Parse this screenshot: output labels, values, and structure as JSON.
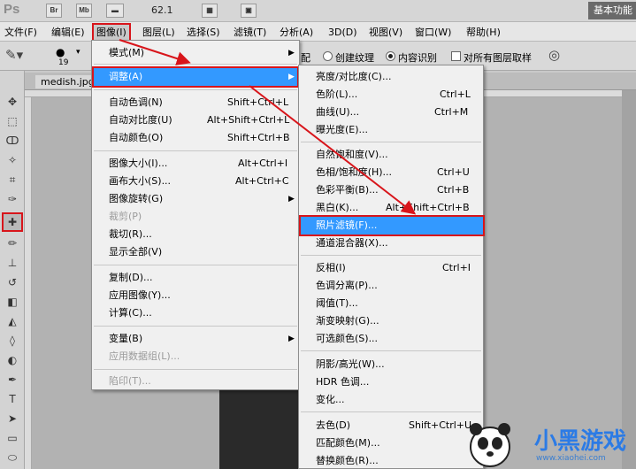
{
  "app": {
    "logo": "Ps",
    "mini_buttons": [
      "Br",
      "Mb"
    ],
    "zoom": "62.1",
    "workspace": "基本功能"
  },
  "menubar": {
    "items": [
      "文件(F)",
      "编辑(E)",
      "图像(I)",
      "图层(L)",
      "选择(S)",
      "滤镜(T)",
      "分析(A)",
      "3D(D)",
      "视图(V)",
      "窗口(W)",
      "帮助(H)"
    ]
  },
  "options": {
    "brush_size": "19",
    "partial_label": "配",
    "radio_create_texture": "创建纹理",
    "radio_content_aware": "内容识别",
    "checkbox_all_layers": "对所有图层取样"
  },
  "document": {
    "tab": "medish.jpg @"
  },
  "image_menu": {
    "items": [
      {
        "label": "模式(M)",
        "shortcut": "",
        "submenu": true,
        "disabled": false
      },
      {
        "label": "调整(A)",
        "shortcut": "",
        "submenu": true,
        "disabled": false
      },
      {
        "label": "自动色调(N)",
        "shortcut": "Shift+Ctrl+L",
        "submenu": false,
        "disabled": false
      },
      {
        "label": "自动对比度(U)",
        "shortcut": "Alt+Shift+Ctrl+L",
        "submenu": false,
        "disabled": false
      },
      {
        "label": "自动颜色(O)",
        "shortcut": "Shift+Ctrl+B",
        "submenu": false,
        "disabled": false
      },
      {
        "label": "图像大小(I)...",
        "shortcut": "Alt+Ctrl+I",
        "submenu": false,
        "disabled": false
      },
      {
        "label": "画布大小(S)...",
        "shortcut": "Alt+Ctrl+C",
        "submenu": false,
        "disabled": false
      },
      {
        "label": "图像旋转(G)",
        "shortcut": "",
        "submenu": true,
        "disabled": false
      },
      {
        "label": "裁剪(P)",
        "shortcut": "",
        "submenu": false,
        "disabled": true
      },
      {
        "label": "裁切(R)...",
        "shortcut": "",
        "submenu": false,
        "disabled": false
      },
      {
        "label": "显示全部(V)",
        "shortcut": "",
        "submenu": false,
        "disabled": false
      },
      {
        "label": "复制(D)...",
        "shortcut": "",
        "submenu": false,
        "disabled": false
      },
      {
        "label": "应用图像(Y)...",
        "shortcut": "",
        "submenu": false,
        "disabled": false
      },
      {
        "label": "计算(C)...",
        "shortcut": "",
        "submenu": false,
        "disabled": false
      },
      {
        "label": "变量(B)",
        "shortcut": "",
        "submenu": true,
        "disabled": false
      },
      {
        "label": "应用数据组(L)...",
        "shortcut": "",
        "submenu": false,
        "disabled": true
      },
      {
        "label": "陷印(T)...",
        "shortcut": "",
        "submenu": false,
        "disabled": true
      }
    ]
  },
  "adjust_menu": {
    "items": [
      {
        "label": "亮度/对比度(C)...",
        "shortcut": ""
      },
      {
        "label": "色阶(L)...",
        "shortcut": "Ctrl+L"
      },
      {
        "label": "曲线(U)...",
        "shortcut": "Ctrl+M"
      },
      {
        "label": "曝光度(E)...",
        "shortcut": ""
      },
      {
        "label": "自然饱和度(V)...",
        "shortcut": ""
      },
      {
        "label": "色相/饱和度(H)...",
        "shortcut": "Ctrl+U"
      },
      {
        "label": "色彩平衡(B)...",
        "shortcut": "Ctrl+B"
      },
      {
        "label": "黑白(K)...",
        "shortcut": "Alt+Shift+Ctrl+B"
      },
      {
        "label": "照片滤镜(F)...",
        "shortcut": ""
      },
      {
        "label": "通道混合器(X)...",
        "shortcut": ""
      },
      {
        "label": "反相(I)",
        "shortcut": "Ctrl+I"
      },
      {
        "label": "色调分离(P)...",
        "shortcut": ""
      },
      {
        "label": "阈值(T)...",
        "shortcut": ""
      },
      {
        "label": "渐变映射(G)...",
        "shortcut": ""
      },
      {
        "label": "可选颜色(S)...",
        "shortcut": ""
      },
      {
        "label": "阴影/高光(W)...",
        "shortcut": ""
      },
      {
        "label": "HDR 色调...",
        "shortcut": ""
      },
      {
        "label": "变化...",
        "shortcut": ""
      },
      {
        "label": "去色(D)",
        "shortcut": "Shift+Ctrl+U"
      },
      {
        "label": "匹配颜色(M)...",
        "shortcut": ""
      },
      {
        "label": "替换颜色(R)...",
        "shortcut": ""
      }
    ]
  },
  "watermark": {
    "logo_text": "小黑游戏",
    "url": "www.xiaohei.com"
  },
  "colors": {
    "highlight": "#3399ff",
    "annotation_red": "#d8151b"
  }
}
